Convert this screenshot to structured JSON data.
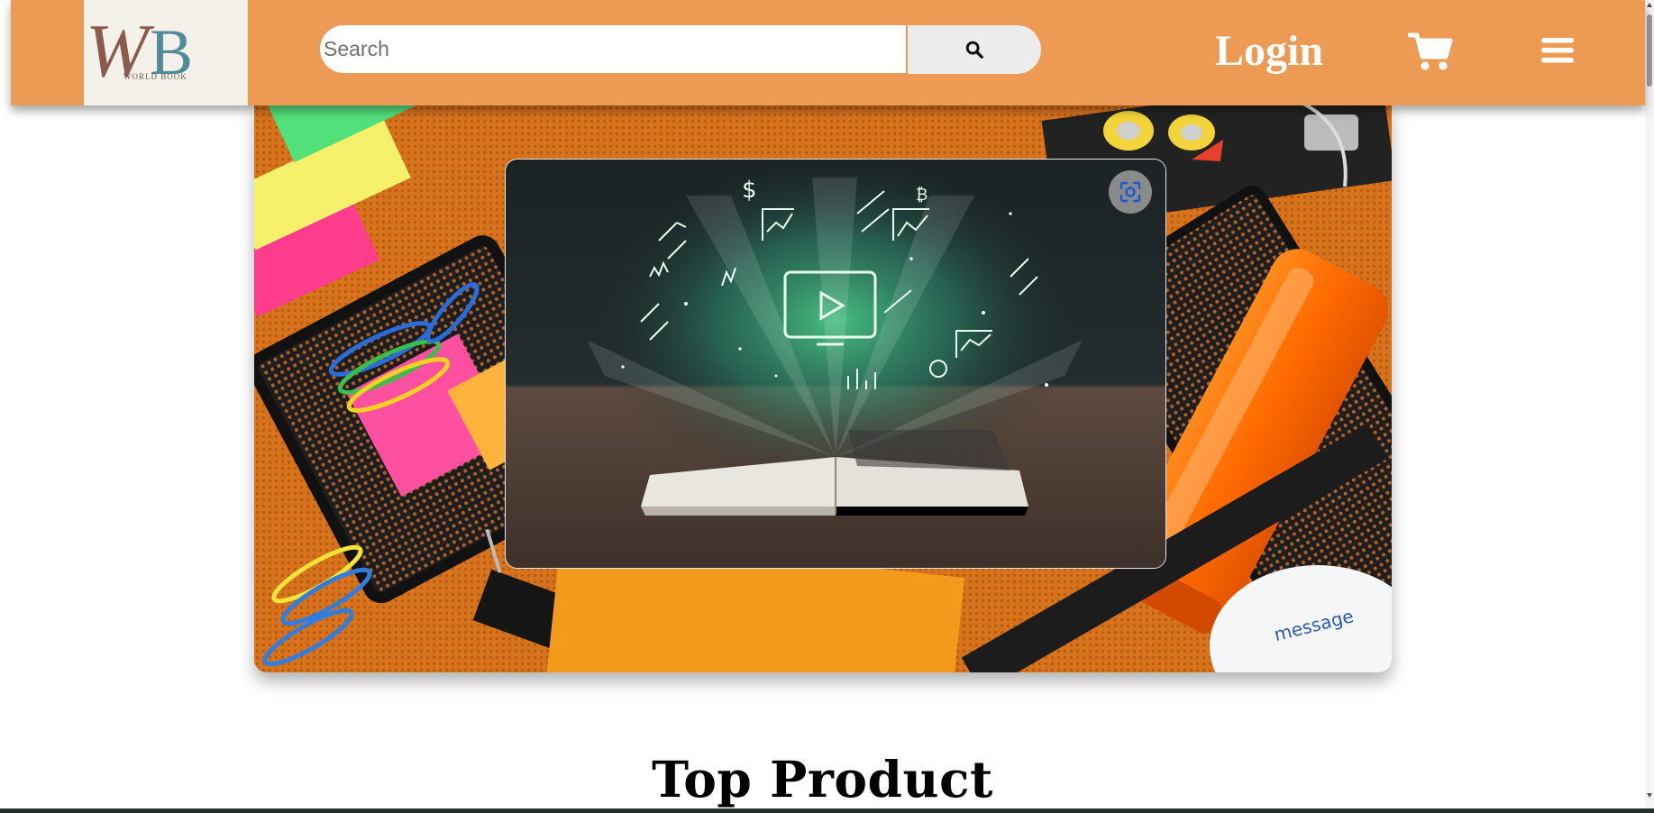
{
  "header": {
    "logo": {
      "letters": "WB",
      "tagline": "WORLD BOOK"
    },
    "search": {
      "placeholder": "Search",
      "value": "",
      "button_icon": "search-icon"
    },
    "login_label": "Login",
    "cart_icon": "shopping-cart-icon",
    "menu_icon": "hamburger-menu-icon",
    "background_color": "#ec9a54"
  },
  "banner": {
    "background": "stationery-flatlay-image",
    "inset_image": "open-book-with-glowing-icons-video-thumbnail",
    "overlay_button_icon": "lens-search-icon",
    "printed_text": "message"
  },
  "main": {
    "section_title": "Top Product"
  }
}
